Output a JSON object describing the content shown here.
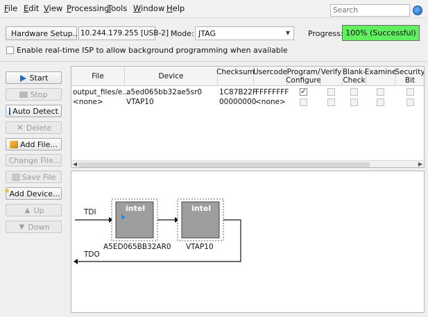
{
  "menu": {
    "items": [
      {
        "first": "F",
        "rest": "ile"
      },
      {
        "first": "E",
        "rest": "dit"
      },
      {
        "first": "V",
        "rest": "iew"
      },
      {
        "first": "P",
        "rest": "rocessing"
      },
      {
        "first": "T",
        "rest": "ools"
      },
      {
        "first": "W",
        "rest": "indow"
      },
      {
        "first": "H",
        "rest": "elp"
      }
    ]
  },
  "search": {
    "placeholder": "Search"
  },
  "hardware": {
    "button_label": "Hardware Setup...",
    "value": "10.244.179.255 [USB-2]"
  },
  "mode": {
    "label": "Mode:",
    "value": "JTAG"
  },
  "progress": {
    "label": "Progress:",
    "text": "100% (Successful)",
    "percent": 100,
    "color": "#5fef5f"
  },
  "isp": {
    "label": "Enable real-time ISP to allow background programming when available",
    "checked": false
  },
  "sidebar": {
    "start": "Start",
    "stop": "Stop",
    "auto_detect": "Auto Detect",
    "delete": "Delete",
    "add_file": "Add File...",
    "change_file": "Change File...",
    "save_file": "Save File",
    "add_device": "Add Device...",
    "up": "Up",
    "down": "Down"
  },
  "table": {
    "headers": {
      "file": "File",
      "device": "Device",
      "checksum": "Checksum",
      "usercode": "Usercode",
      "program_1": "Program/",
      "program_2": "Configure",
      "verify": "Verify",
      "blank_1": "Blank-",
      "blank_2": "Check",
      "examine": "Examine",
      "security_1": "Security",
      "security_2": "Bit"
    },
    "rows": [
      {
        "file": "output_files/e...",
        "device": "a5ed065bb32ae5sr0",
        "checksum": "1C87B22F",
        "usercode": "FFFFFFFF",
        "program": true
      },
      {
        "file": "<none>",
        "device": "VTAP10",
        "checksum": "00000000",
        "usercode": "<none>",
        "program": false
      }
    ]
  },
  "chain": {
    "tdi": "TDI",
    "tdo": "TDO",
    "chip1_logo": "intel",
    "chip2_logo": "intel",
    "chip1_name": "A5ED065BB32AR0",
    "chip2_name": "VTAP10"
  }
}
